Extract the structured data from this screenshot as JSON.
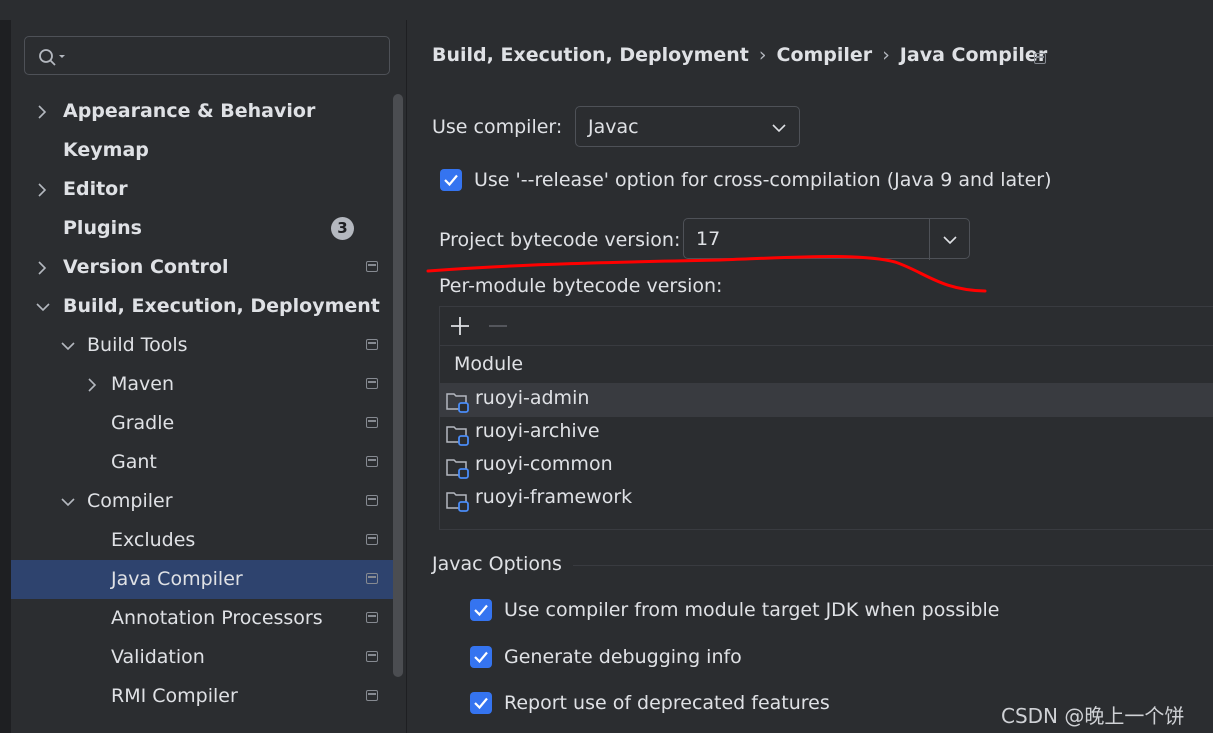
{
  "search": {
    "placeholder": ""
  },
  "sidebar": {
    "items": [
      {
        "label": "Appearance & Behavior"
      },
      {
        "label": "Keymap"
      },
      {
        "label": "Editor"
      },
      {
        "label": "Plugins",
        "badge": "3"
      },
      {
        "label": "Version Control"
      },
      {
        "label": "Build, Execution, Deployment"
      },
      {
        "label": "Build Tools"
      },
      {
        "label": "Maven"
      },
      {
        "label": "Gradle"
      },
      {
        "label": "Gant"
      },
      {
        "label": "Compiler"
      },
      {
        "label": "Excludes"
      },
      {
        "label": "Java Compiler"
      },
      {
        "label": "Annotation Processors"
      },
      {
        "label": "Validation"
      },
      {
        "label": "RMI Compiler"
      }
    ]
  },
  "breadcrumb": {
    "items": [
      "Build, Execution, Deployment",
      "Compiler",
      "Java Compiler"
    ],
    "separator": "›"
  },
  "compiler": {
    "use_compiler_label": "Use compiler:",
    "use_compiler_value": "Javac",
    "release_option_label": "Use '--release' option for cross-compilation (Java 9 and later)",
    "release_option_checked": true,
    "bytecode_label": "Project bytecode version:",
    "bytecode_value": "17",
    "per_module_label": "Per-module bytecode version:"
  },
  "module_table": {
    "add_icon": "plus-icon",
    "remove_icon": "minus-icon",
    "header": "Module",
    "rows": [
      "ruoyi-admin",
      "ruoyi-archive",
      "ruoyi-common",
      "ruoyi-framework"
    ]
  },
  "javac_options": {
    "title": "Javac Options",
    "options": [
      {
        "label": "Use compiler from module target JDK when possible",
        "checked": true
      },
      {
        "label": "Generate debugging info",
        "checked": true
      },
      {
        "label": "Report use of deprecated features",
        "checked": true
      }
    ]
  },
  "watermark": "CSDN @晚上一个饼",
  "colors": {
    "accent": "#3574f0",
    "selection": "#2e436e",
    "annotation": "#ff0000"
  }
}
